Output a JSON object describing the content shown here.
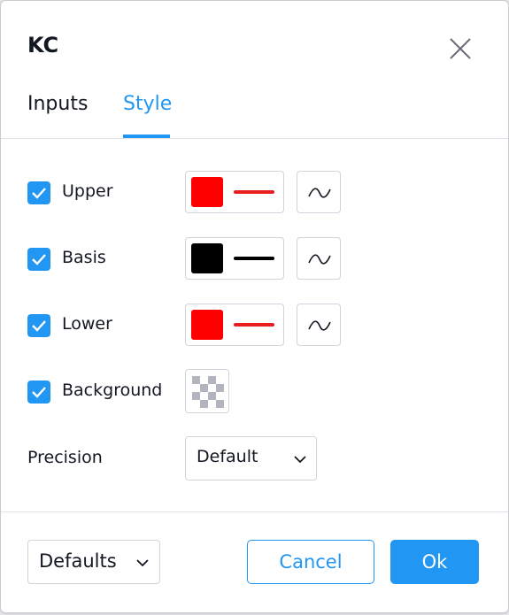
{
  "dialog": {
    "title": "KC"
  },
  "tabs": [
    {
      "label": "Inputs",
      "active": false
    },
    {
      "label": "Style",
      "active": true
    }
  ],
  "rows": [
    {
      "label": "Upper",
      "checked": true,
      "color": "#ff0000",
      "line_color": "#e91e1e"
    },
    {
      "label": "Basis",
      "checked": true,
      "color": "#000000",
      "line_color": "#000000"
    },
    {
      "label": "Lower",
      "checked": true,
      "color": "#ff0000",
      "line_color": "#e91e1e"
    }
  ],
  "background": {
    "label": "Background",
    "checked": true
  },
  "precision": {
    "label": "Precision",
    "value": "Default"
  },
  "footer": {
    "defaults_label": "Defaults",
    "cancel_label": "Cancel",
    "ok_label": "Ok"
  },
  "colors": {
    "accent": "#2196f3",
    "text": "#131722",
    "border": "#d1d4dc"
  },
  "icons": {
    "close": "close-icon",
    "check": "check-icon",
    "plot_style": "line-wave-icon",
    "transparency": "checkerboard-icon",
    "chevron": "chevron-down-icon"
  }
}
